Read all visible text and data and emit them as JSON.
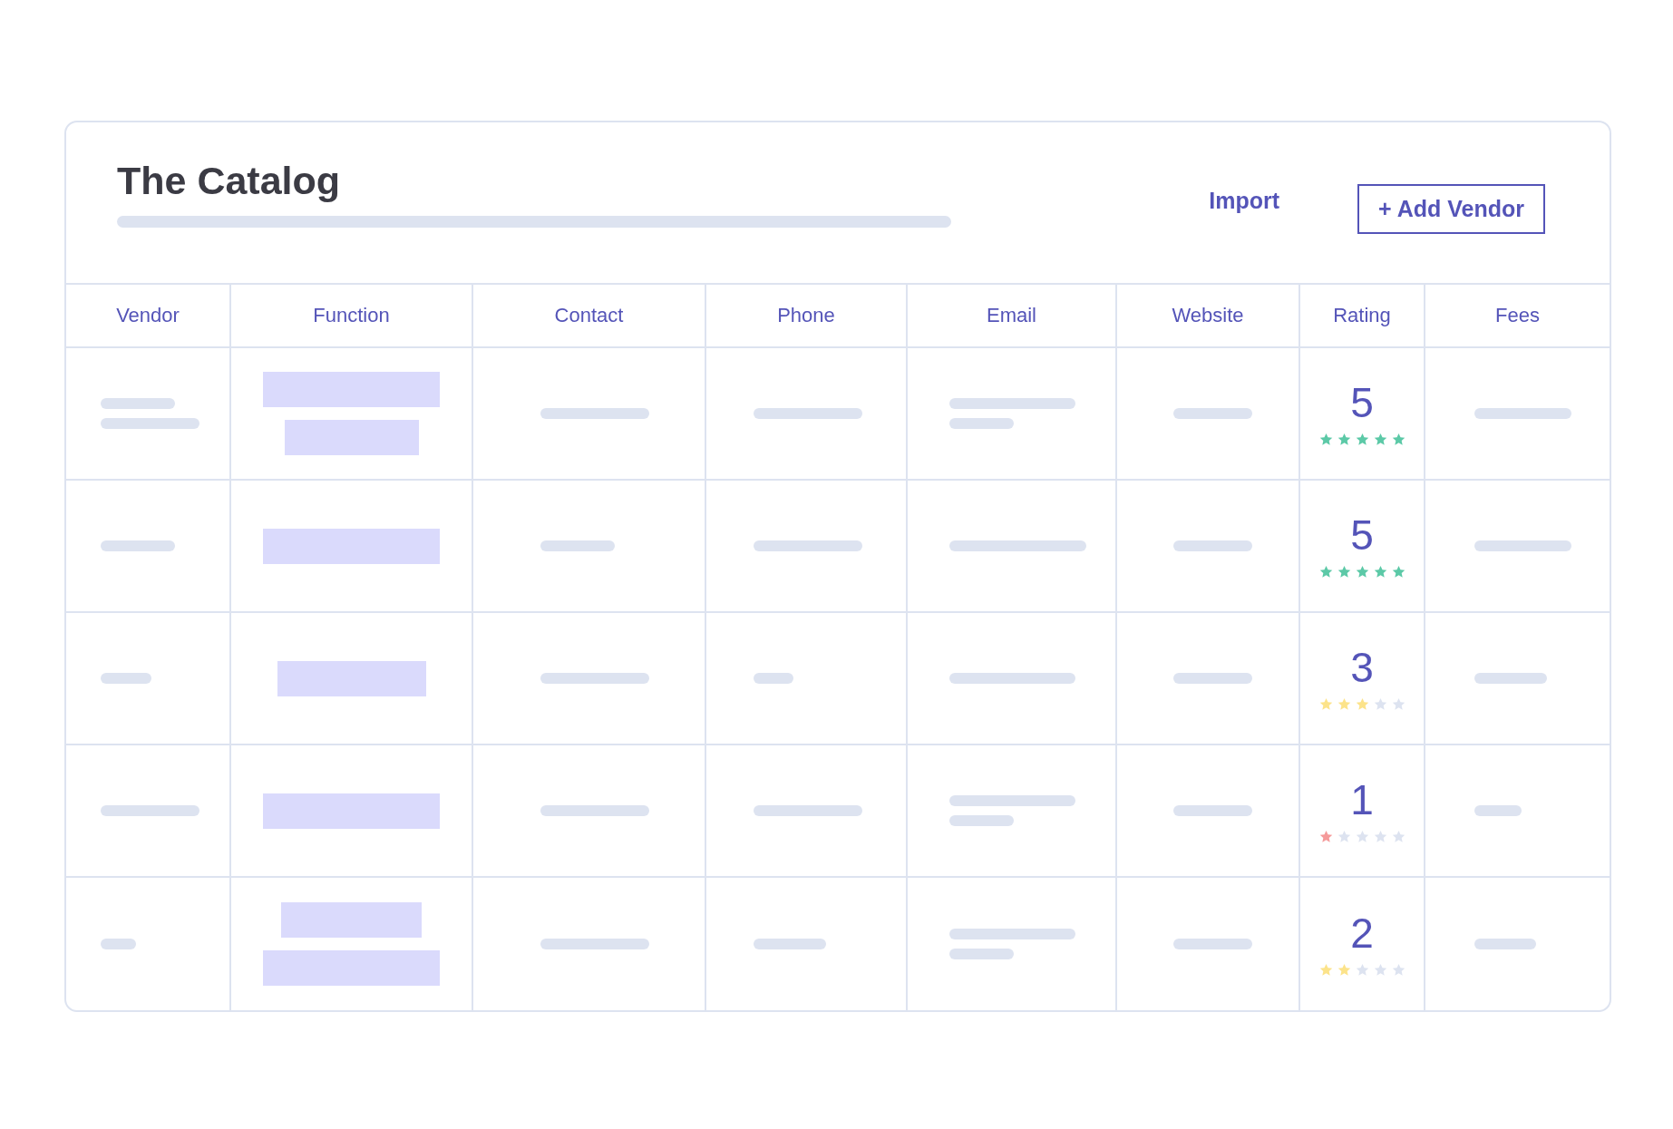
{
  "title": "The Catalog",
  "actions": {
    "import": "Import",
    "add": "+ Add Vendor"
  },
  "columns": [
    "Vendor",
    "Function",
    "Contact",
    "Phone",
    "Email",
    "Website",
    "Rating",
    "Fees"
  ],
  "rows": [
    {
      "rating": "5",
      "stars": 5,
      "color": "#5cc9a7"
    },
    {
      "rating": "5",
      "stars": 5,
      "color": "#5cc9a7"
    },
    {
      "rating": "3",
      "stars": 3,
      "color": "#fce38a"
    },
    {
      "rating": "1",
      "stars": 1,
      "color": "#f59a9a"
    },
    {
      "rating": "2",
      "stars": 2,
      "color": "#fce38a"
    }
  ]
}
